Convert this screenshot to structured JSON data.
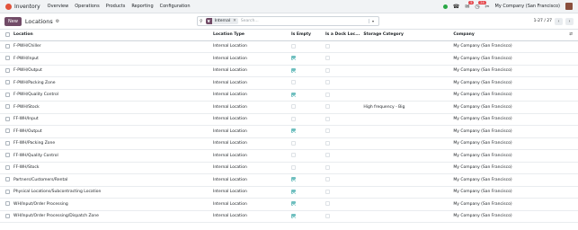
{
  "navbar": {
    "app_name": "Inventory",
    "menu": [
      "Overview",
      "Operations",
      "Products",
      "Reporting",
      "Configuration"
    ],
    "messages_count": "5",
    "activities_count": "24",
    "company": "My Company (San Francisco)"
  },
  "control": {
    "new_label": "New",
    "page_title": "Locations",
    "search": {
      "facet": "Internal",
      "placeholder": "Search..."
    },
    "pager": "1-27 / 27"
  },
  "table": {
    "columns": [
      "Location",
      "Location Type",
      "Is Empty",
      "Is a Dock Loc...",
      "Storage Category",
      "Company"
    ],
    "rows": [
      {
        "location": "F-PWH/Chiller",
        "type": "Internal Location",
        "empty": false,
        "dock": false,
        "storage": "",
        "company": "My Company (San Francisco)"
      },
      {
        "location": "F-PWH/Input",
        "type": "Internal Location",
        "empty": true,
        "dock": false,
        "storage": "",
        "company": "My Company (San Francisco)"
      },
      {
        "location": "F-PWH/Output",
        "type": "Internal Location",
        "empty": true,
        "dock": false,
        "storage": "",
        "company": "My Company (San Francisco)"
      },
      {
        "location": "F-PWH/Packing Zone",
        "type": "Internal Location",
        "empty": false,
        "dock": false,
        "storage": "",
        "company": "My Company (San Francisco)"
      },
      {
        "location": "F-PWH/Quality Control",
        "type": "Internal Location",
        "empty": true,
        "dock": false,
        "storage": "",
        "company": "My Company (San Francisco)"
      },
      {
        "location": "F-PWH/Stock",
        "type": "Internal Location",
        "empty": false,
        "dock": false,
        "storage": "High frequency - Big",
        "company": "My Company (San Francisco)"
      },
      {
        "location": "FF-WH/Input",
        "type": "Internal Location",
        "empty": false,
        "dock": false,
        "storage": "",
        "company": "My Company (San Francisco)"
      },
      {
        "location": "FF-WH/Output",
        "type": "Internal Location",
        "empty": true,
        "dock": false,
        "storage": "",
        "company": "My Company (San Francisco)"
      },
      {
        "location": "FF-WH/Packing Zone",
        "type": "Internal Location",
        "empty": false,
        "dock": false,
        "storage": "",
        "company": "My Company (San Francisco)"
      },
      {
        "location": "FF-WH/Quality Control",
        "type": "Internal Location",
        "empty": false,
        "dock": false,
        "storage": "",
        "company": "My Company (San Francisco)"
      },
      {
        "location": "FF-WH/Stock",
        "type": "Internal Location",
        "empty": false,
        "dock": false,
        "storage": "",
        "company": "My Company (San Francisco)"
      },
      {
        "location": "Partners/Customers/Rental",
        "type": "Internal Location",
        "empty": true,
        "dock": false,
        "storage": "",
        "company": "My Company (San Francisco)"
      },
      {
        "location": "Physical Locations/Subcontracting Location",
        "type": "Internal Location",
        "empty": true,
        "dock": false,
        "storage": "",
        "company": "My Company (San Francisco)"
      },
      {
        "location": "WH/Input/Order Processing",
        "type": "Internal Location",
        "empty": true,
        "dock": false,
        "storage": "",
        "company": "My Company (San Francisco)"
      },
      {
        "location": "WH/Input/Order Processing/Dispatch Zone",
        "type": "Internal Location",
        "empty": true,
        "dock": false,
        "storage": "",
        "company": "My Company (San Francisco)"
      }
    ]
  },
  "colors": {
    "brand": "#714b67",
    "check": "#6fbfbf",
    "navbar_bg": "#f1f3f5"
  }
}
